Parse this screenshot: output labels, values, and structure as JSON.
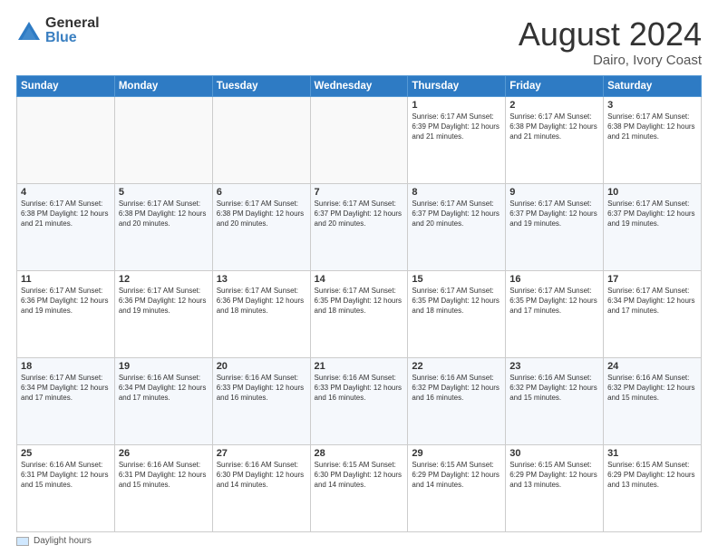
{
  "logo": {
    "general": "General",
    "blue": "Blue"
  },
  "title": {
    "month_year": "August 2024",
    "location": "Dairo, Ivory Coast"
  },
  "days_of_week": [
    "Sunday",
    "Monday",
    "Tuesday",
    "Wednesday",
    "Thursday",
    "Friday",
    "Saturday"
  ],
  "weeks": [
    [
      {
        "day": "",
        "info": ""
      },
      {
        "day": "",
        "info": ""
      },
      {
        "day": "",
        "info": ""
      },
      {
        "day": "",
        "info": ""
      },
      {
        "day": "1",
        "info": "Sunrise: 6:17 AM\nSunset: 6:39 PM\nDaylight: 12 hours\nand 21 minutes."
      },
      {
        "day": "2",
        "info": "Sunrise: 6:17 AM\nSunset: 6:38 PM\nDaylight: 12 hours\nand 21 minutes."
      },
      {
        "day": "3",
        "info": "Sunrise: 6:17 AM\nSunset: 6:38 PM\nDaylight: 12 hours\nand 21 minutes."
      }
    ],
    [
      {
        "day": "4",
        "info": "Sunrise: 6:17 AM\nSunset: 6:38 PM\nDaylight: 12 hours\nand 21 minutes."
      },
      {
        "day": "5",
        "info": "Sunrise: 6:17 AM\nSunset: 6:38 PM\nDaylight: 12 hours\nand 20 minutes."
      },
      {
        "day": "6",
        "info": "Sunrise: 6:17 AM\nSunset: 6:38 PM\nDaylight: 12 hours\nand 20 minutes."
      },
      {
        "day": "7",
        "info": "Sunrise: 6:17 AM\nSunset: 6:37 PM\nDaylight: 12 hours\nand 20 minutes."
      },
      {
        "day": "8",
        "info": "Sunrise: 6:17 AM\nSunset: 6:37 PM\nDaylight: 12 hours\nand 20 minutes."
      },
      {
        "day": "9",
        "info": "Sunrise: 6:17 AM\nSunset: 6:37 PM\nDaylight: 12 hours\nand 19 minutes."
      },
      {
        "day": "10",
        "info": "Sunrise: 6:17 AM\nSunset: 6:37 PM\nDaylight: 12 hours\nand 19 minutes."
      }
    ],
    [
      {
        "day": "11",
        "info": "Sunrise: 6:17 AM\nSunset: 6:36 PM\nDaylight: 12 hours\nand 19 minutes."
      },
      {
        "day": "12",
        "info": "Sunrise: 6:17 AM\nSunset: 6:36 PM\nDaylight: 12 hours\nand 19 minutes."
      },
      {
        "day": "13",
        "info": "Sunrise: 6:17 AM\nSunset: 6:36 PM\nDaylight: 12 hours\nand 18 minutes."
      },
      {
        "day": "14",
        "info": "Sunrise: 6:17 AM\nSunset: 6:35 PM\nDaylight: 12 hours\nand 18 minutes."
      },
      {
        "day": "15",
        "info": "Sunrise: 6:17 AM\nSunset: 6:35 PM\nDaylight: 12 hours\nand 18 minutes."
      },
      {
        "day": "16",
        "info": "Sunrise: 6:17 AM\nSunset: 6:35 PM\nDaylight: 12 hours\nand 17 minutes."
      },
      {
        "day": "17",
        "info": "Sunrise: 6:17 AM\nSunset: 6:34 PM\nDaylight: 12 hours\nand 17 minutes."
      }
    ],
    [
      {
        "day": "18",
        "info": "Sunrise: 6:17 AM\nSunset: 6:34 PM\nDaylight: 12 hours\nand 17 minutes."
      },
      {
        "day": "19",
        "info": "Sunrise: 6:16 AM\nSunset: 6:34 PM\nDaylight: 12 hours\nand 17 minutes."
      },
      {
        "day": "20",
        "info": "Sunrise: 6:16 AM\nSunset: 6:33 PM\nDaylight: 12 hours\nand 16 minutes."
      },
      {
        "day": "21",
        "info": "Sunrise: 6:16 AM\nSunset: 6:33 PM\nDaylight: 12 hours\nand 16 minutes."
      },
      {
        "day": "22",
        "info": "Sunrise: 6:16 AM\nSunset: 6:32 PM\nDaylight: 12 hours\nand 16 minutes."
      },
      {
        "day": "23",
        "info": "Sunrise: 6:16 AM\nSunset: 6:32 PM\nDaylight: 12 hours\nand 15 minutes."
      },
      {
        "day": "24",
        "info": "Sunrise: 6:16 AM\nSunset: 6:32 PM\nDaylight: 12 hours\nand 15 minutes."
      }
    ],
    [
      {
        "day": "25",
        "info": "Sunrise: 6:16 AM\nSunset: 6:31 PM\nDaylight: 12 hours\nand 15 minutes."
      },
      {
        "day": "26",
        "info": "Sunrise: 6:16 AM\nSunset: 6:31 PM\nDaylight: 12 hours\nand 15 minutes."
      },
      {
        "day": "27",
        "info": "Sunrise: 6:16 AM\nSunset: 6:30 PM\nDaylight: 12 hours\nand 14 minutes."
      },
      {
        "day": "28",
        "info": "Sunrise: 6:15 AM\nSunset: 6:30 PM\nDaylight: 12 hours\nand 14 minutes."
      },
      {
        "day": "29",
        "info": "Sunrise: 6:15 AM\nSunset: 6:29 PM\nDaylight: 12 hours\nand 14 minutes."
      },
      {
        "day": "30",
        "info": "Sunrise: 6:15 AM\nSunset: 6:29 PM\nDaylight: 12 hours\nand 13 minutes."
      },
      {
        "day": "31",
        "info": "Sunrise: 6:15 AM\nSunset: 6:29 PM\nDaylight: 12 hours\nand 13 minutes."
      }
    ]
  ],
  "footer": {
    "label": "Daylight hours"
  }
}
